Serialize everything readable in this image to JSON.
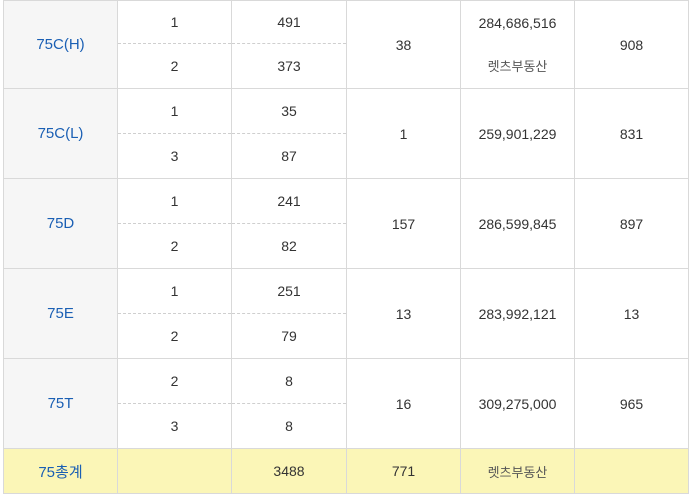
{
  "rows": [
    {
      "type": "75C(H)",
      "sub": [
        {
          "floor": "1",
          "count": "491"
        },
        {
          "floor": "2",
          "count": "373"
        }
      ],
      "col4": "38",
      "price": "284,686,516",
      "note": "렛츠부동산",
      "col6": "908"
    },
    {
      "type": "75C(L)",
      "sub": [
        {
          "floor": "1",
          "count": "35"
        },
        {
          "floor": "3",
          "count": "87"
        }
      ],
      "col4": "1",
      "price": "259,901,229",
      "note": "",
      "col6": "831"
    },
    {
      "type": "75D",
      "sub": [
        {
          "floor": "1",
          "count": "241"
        },
        {
          "floor": "2",
          "count": "82"
        }
      ],
      "col4": "157",
      "price": "286,599,845",
      "note": "",
      "col6": "897"
    },
    {
      "type": "75E",
      "sub": [
        {
          "floor": "1",
          "count": "251"
        },
        {
          "floor": "2",
          "count": "79"
        }
      ],
      "col4": "13",
      "price": "283,992,121",
      "note": "",
      "col6": "13"
    },
    {
      "type": "75T",
      "sub": [
        {
          "floor": "2",
          "count": "8"
        },
        {
          "floor": "3",
          "count": "8"
        }
      ],
      "col4": "16",
      "price": "309,275,000",
      "note": "",
      "col6": "965"
    }
  ],
  "total": {
    "label": "75총계",
    "sum": "3488",
    "col4": "771",
    "note": "렛츠부동산"
  }
}
